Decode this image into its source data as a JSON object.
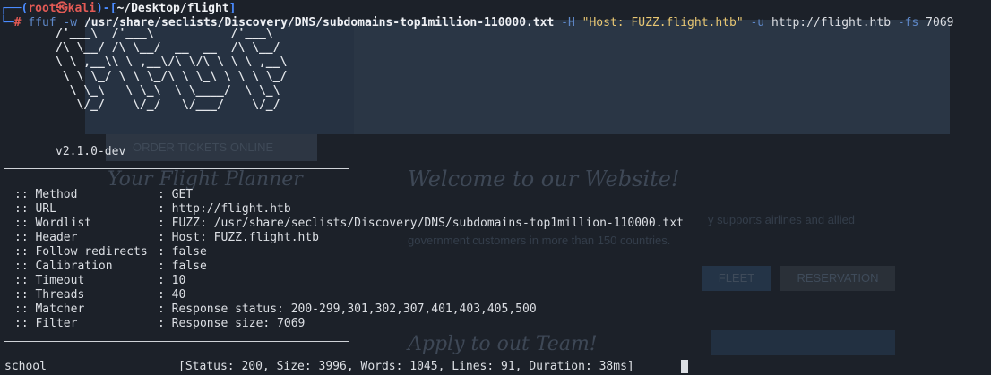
{
  "prompt": {
    "line1_open": "┌──(",
    "user": "root",
    "skull": "㉿",
    "host": "kali",
    "line1_mid": ")-[",
    "cwd": "~/Desktop/flight",
    "line1_close": "]",
    "line2_prefix": "└─",
    "hash": "#"
  },
  "command": {
    "bin": "ffuf",
    "flag_w": "-w",
    "wordlist": "/usr/share/seclists/Discovery/DNS/subdomains-top1million-110000.txt",
    "flag_H": "-H",
    "header": "\"Host: FUZZ.flight.htb\"",
    "flag_u": "-u",
    "url": "http://flight.htb",
    "flag_fs": "-fs",
    "fs_value": "7069"
  },
  "banner": {
    "art": "/'___\\  /'___\\           /'___\\\n/\\ \\__/ /\\ \\__/  __  __  /\\ \\__/\n\\ \\ ,__\\\\ \\ ,__\\/\\ \\/\\ \\ \\ \\ ,__\\\n \\ \\ \\_/ \\ \\ \\_/\\ \\ \\_\\ \\ \\ \\ \\_/\n  \\ \\_\\   \\ \\_\\  \\ \\____/  \\ \\_\\\n   \\/_/    \\/_/   \\/___/    \\/_/",
    "version": "v2.1.0-dev"
  },
  "config": [
    {
      "key": ":: Method",
      "value": ": GET"
    },
    {
      "key": ":: URL",
      "value": ": http://flight.htb"
    },
    {
      "key": ":: Wordlist",
      "value": ": FUZZ: /usr/share/seclists/Discovery/DNS/subdomains-top1million-110000.txt"
    },
    {
      "key": ":: Header",
      "value": ": Host: FUZZ.flight.htb"
    },
    {
      "key": ":: Follow redirects",
      "value": ": false"
    },
    {
      "key": ":: Calibration",
      "value": ": false"
    },
    {
      "key": ":: Timeout",
      "value": ": 10"
    },
    {
      "key": ":: Threads",
      "value": ": 40"
    },
    {
      "key": ":: Matcher",
      "value": ": Response status: 200-299,301,302,307,401,403,405,500"
    },
    {
      "key": ":: Filter",
      "value": ": Response size: 7069"
    }
  ],
  "result": {
    "word": "school",
    "details": "[Status: 200, Size: 3996, Words: 1045, Lines: 91, Duration: 38ms]"
  },
  "background_site": {
    "order_button": "ORDER TICKETS ONLINE",
    "planner_heading": "Your Flight Planner",
    "welcome_heading": "Welcome to our Website!",
    "welcome_text_1": "y supports airlines and allied",
    "welcome_text_2": "government customers in more than 150 countries.",
    "fleet_button": "FLEET",
    "reservation_button": "RESERVATION",
    "apply_heading": "Apply to out Team!"
  }
}
